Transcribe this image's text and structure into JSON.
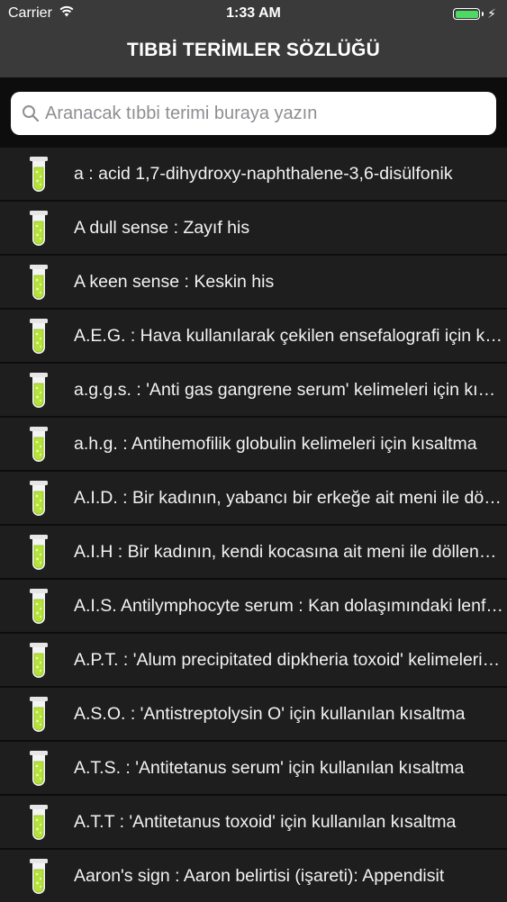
{
  "status_bar": {
    "carrier": "Carrier",
    "time": "1:33 AM",
    "battery_color": "#4cd964"
  },
  "nav": {
    "title": "TIBBİ TERİMLER SÖZLÜĞÜ"
  },
  "search": {
    "placeholder": "Aranacak tıbbi terimi buraya yazın",
    "value": ""
  },
  "list": {
    "icon": "test-tube-icon",
    "items": [
      "a : acid 1,7-dihydroxy-naphthalene-3,6-disülfonik",
      "A dull sense : Zayıf his",
      "A keen sense : Keskin his",
      "A.E.G. : Hava kullanılarak çekilen ensefalografi için kısaltma",
      "a.g.g.s. : 'Anti gas gangrene serum' kelimeleri için kısaltma",
      "a.h.g.  :  Antihemofilik globulin kelimeleri için kısaltma",
      "A.I.D.  :  Bir kadının, yabancı bir erkeğe ait meni ile döllenmesi",
      "A.I.H  :  Bir kadının, kendi kocasına ait meni ile döllenmesi",
      "A.I.S. Antilymphocyte serum  :  Kan dolaşımındaki lenfositlere karşı serum",
      "A.P.T.  :  'Alum precipitated dipkheria toxoid' kelimeleri için kısaltma",
      "A.S.O.  :  'Antistreptolysin O' için kullanılan kısaltma",
      "A.T.S.  :  'Antitetanus serum' için kullanılan kısaltma",
      "A.T.T  :  'Antitetanus toxoid' için kullanılan kısaltma",
      "Aaron's sign  :  Aaron belirtisi (işareti): Appendisit"
    ]
  }
}
